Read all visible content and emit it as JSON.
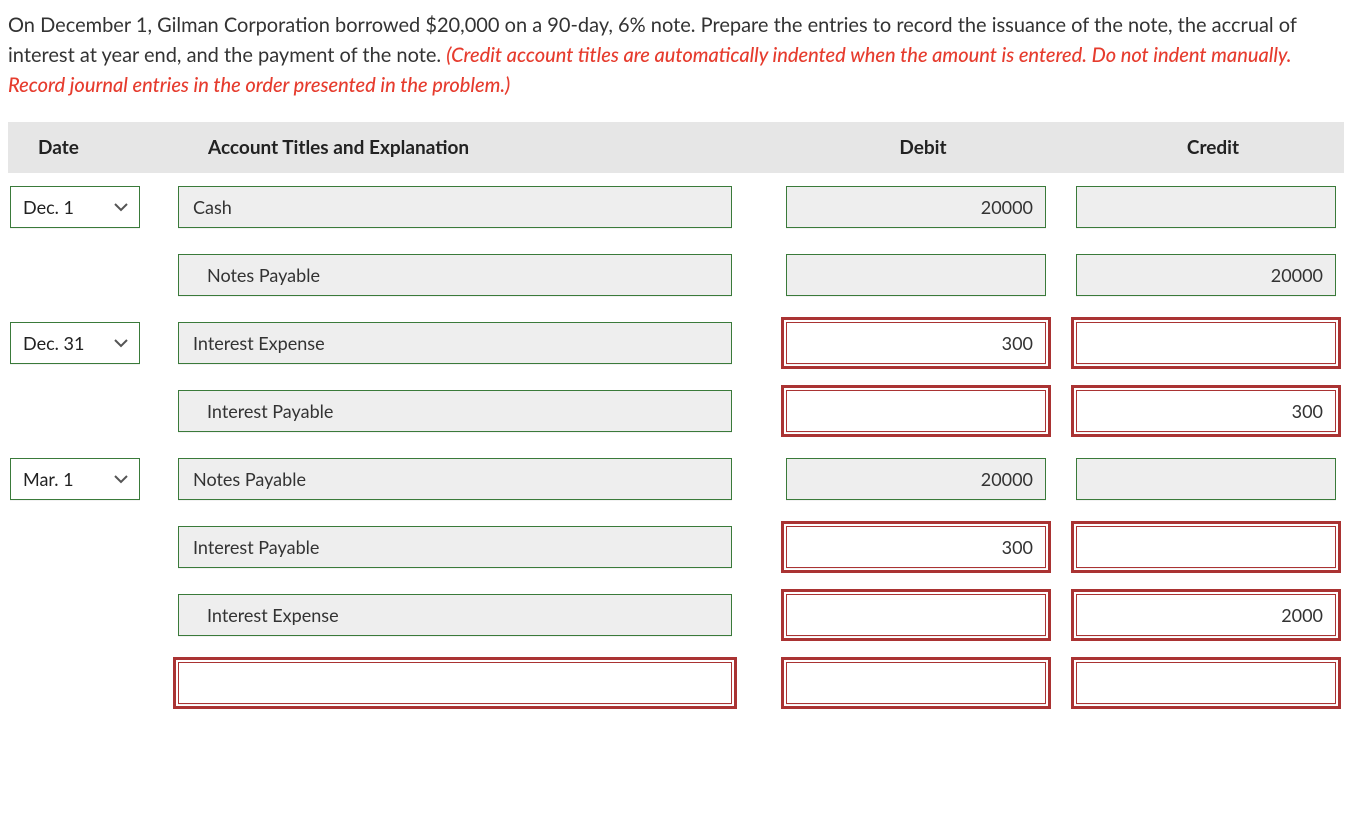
{
  "question": {
    "text_part1": "On December 1, Gilman Corporation borrowed $20,000 on a 90-day, 6% note. Prepare the entries to record the issuance of the note, the accrual of interest at year end, and the payment of the note. ",
    "hint": "(Credit account titles are automatically indented when the amount is entered. Do not indent manually. Record journal entries in the order presented in the problem.)"
  },
  "headers": {
    "date": "Date",
    "account": "Account Titles and Explanation",
    "debit": "Debit",
    "credit": "Credit"
  },
  "rows": [
    {
      "date": "Dec. 1",
      "date_shown": true,
      "account": "Cash",
      "indented": false,
      "debit": "20000",
      "credit": "",
      "acct_bad": false,
      "debit_bad": false,
      "credit_bad": false
    },
    {
      "date": "",
      "date_shown": false,
      "account": "Notes Payable",
      "indented": true,
      "debit": "",
      "credit": "20000",
      "acct_bad": false,
      "debit_bad": false,
      "credit_bad": false
    },
    {
      "date": "Dec. 31",
      "date_shown": true,
      "account": "Interest Expense",
      "indented": false,
      "debit": "300",
      "credit": "",
      "acct_bad": false,
      "debit_bad": true,
      "credit_bad": true
    },
    {
      "date": "",
      "date_shown": false,
      "account": "Interest Payable",
      "indented": true,
      "debit": "",
      "credit": "300",
      "acct_bad": false,
      "debit_bad": true,
      "credit_bad": true
    },
    {
      "date": "Mar. 1",
      "date_shown": true,
      "account": "Notes Payable",
      "indented": false,
      "debit": "20000",
      "credit": "",
      "acct_bad": false,
      "debit_bad": false,
      "credit_bad": false
    },
    {
      "date": "",
      "date_shown": false,
      "account": "Interest Payable",
      "indented": false,
      "debit": "300",
      "credit": "",
      "acct_bad": false,
      "debit_bad": true,
      "credit_bad": true
    },
    {
      "date": "",
      "date_shown": false,
      "account": "Interest Expense",
      "indented": true,
      "debit": "",
      "credit": "2000",
      "acct_bad": false,
      "debit_bad": true,
      "credit_bad": true
    },
    {
      "date": "",
      "date_shown": false,
      "account": "",
      "indented": false,
      "debit": "",
      "credit": "",
      "acct_bad": true,
      "debit_bad": true,
      "credit_bad": true
    }
  ]
}
